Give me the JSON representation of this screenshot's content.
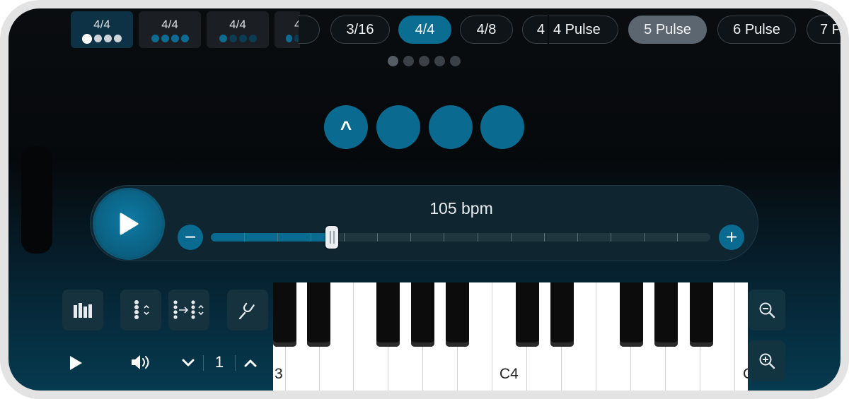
{
  "time_signatures": [
    {
      "label": "4/4",
      "active": true
    },
    {
      "label": "4/4",
      "active": false
    },
    {
      "label": "4/4",
      "active": false
    },
    {
      "label": "4",
      "active": false
    }
  ],
  "subdivision_pills": [
    "3/16",
    "4/4",
    "4/8",
    "4"
  ],
  "selected_subdivision": "4/4",
  "pulse_pills": [
    "4 Pulse",
    "5 Pulse",
    "6 Pulse",
    "7 P"
  ],
  "selected_pulse": "5 Pulse",
  "page_indicator": {
    "count": 5,
    "current": 1
  },
  "beats": {
    "count": 4,
    "accent_glyph": "^"
  },
  "tempo": {
    "label": "105 bpm",
    "value": 105,
    "slider_fraction": 0.24
  },
  "icons": {
    "play": "play-icon",
    "minus": "minus-icon",
    "plus": "plus-icon",
    "library": "library-icon",
    "beats": "beat-count-icon",
    "subdivide": "subdivide-icon",
    "tuner": "tuning-fork-icon",
    "volume": "speaker-icon",
    "zoom_out": "zoom-out-icon",
    "zoom_in": "zoom-in-icon"
  },
  "controls": {
    "minus_label": "−",
    "plus_label": "+",
    "octave": "1"
  },
  "piano": {
    "labels": {
      "left": "3",
      "c4": "C4",
      "right": "C"
    }
  },
  "colors": {
    "accent": "#0b6a8f",
    "background": "#06090c"
  }
}
